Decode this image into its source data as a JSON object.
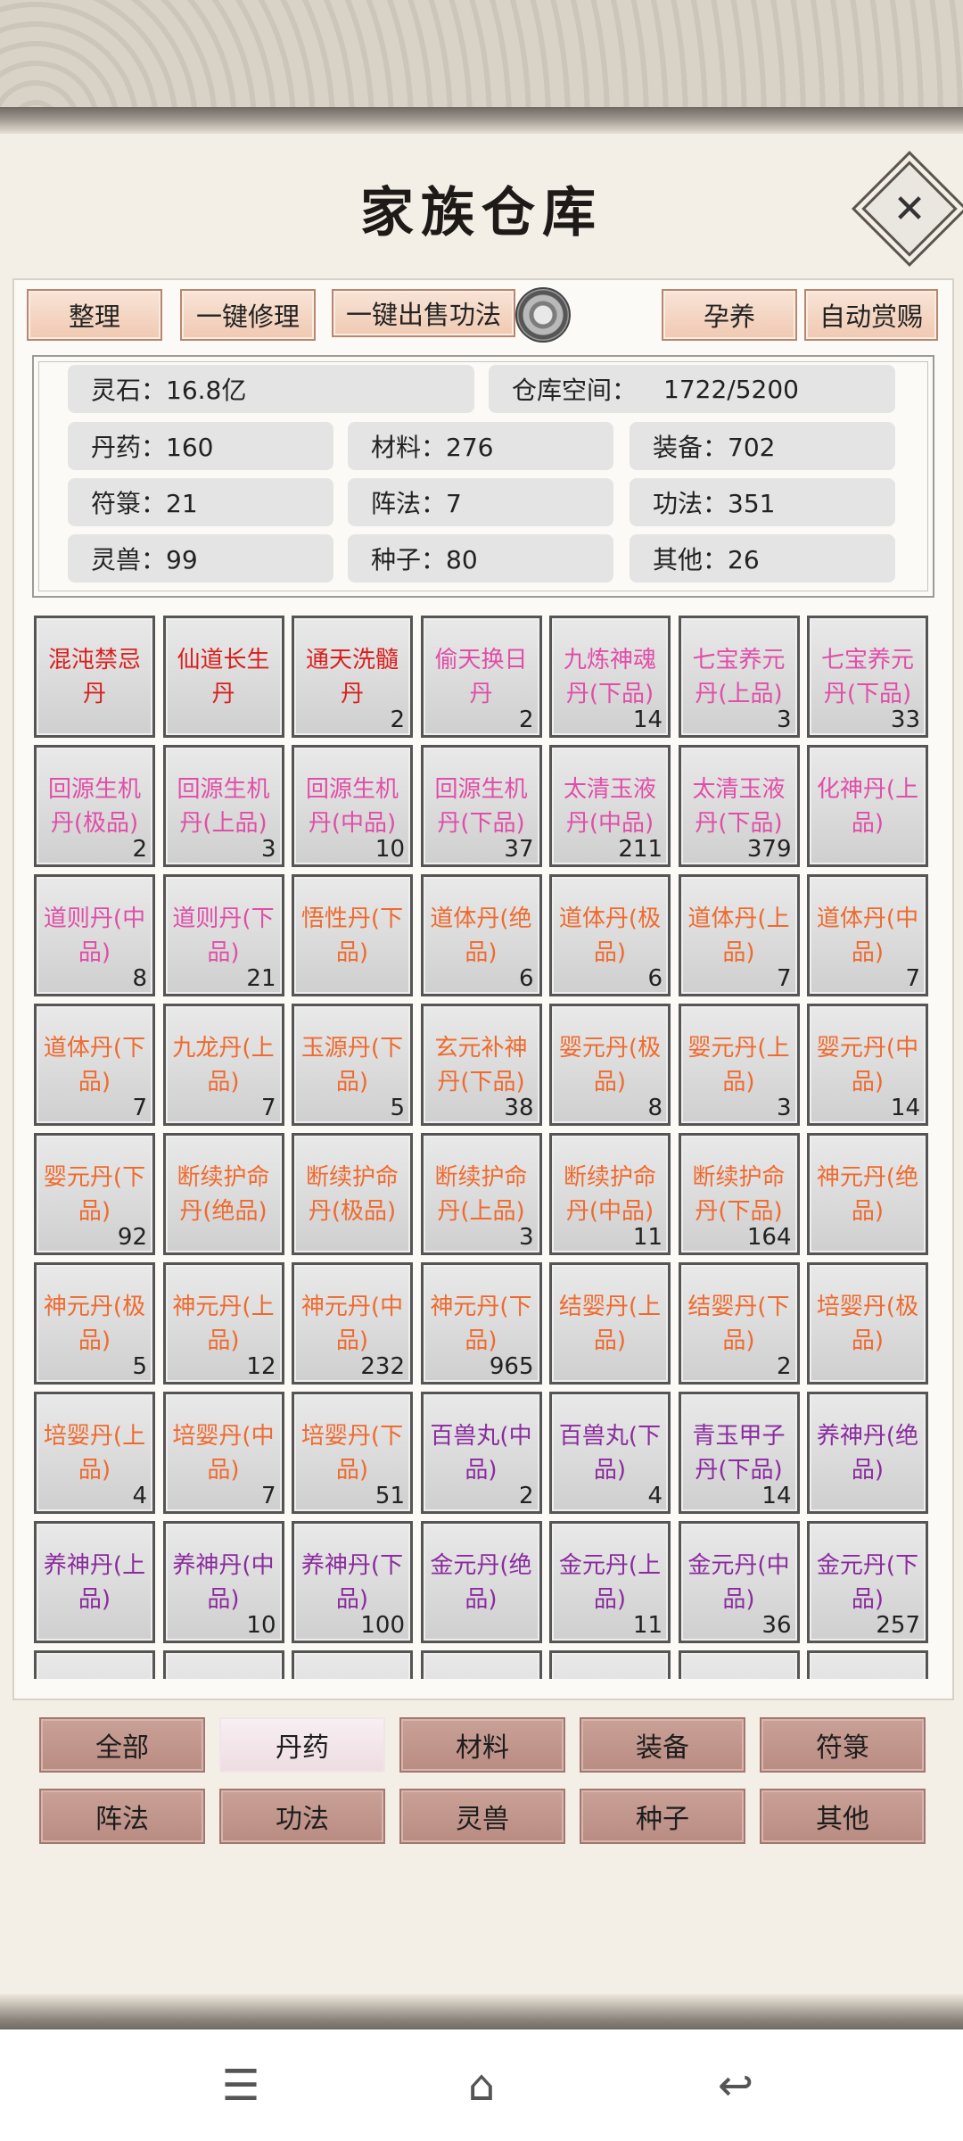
{
  "title": "家族仓库",
  "close_icon": "✕",
  "toolbar": {
    "sort": "整理",
    "repair": "一键修理",
    "sell_techniques": "一键出售功法",
    "nurture": "孕养",
    "auto_reward": "自动赏赐"
  },
  "stats": {
    "spirit_stone": "灵石：16.8亿",
    "storage_label": "仓库空间：",
    "storage_value": "1722/5200",
    "pills": "丹药：160",
    "materials": "材料：276",
    "equipment": "装备：702",
    "talismans": "符箓：21",
    "formations": "阵法：7",
    "techniques": "功法：351",
    "beasts": "灵兽：99",
    "seeds": "种子：80",
    "others": "其他：26"
  },
  "colors": {
    "red": "#d8201e",
    "magenta": "#e04ea8",
    "orange": "#ef6a2e",
    "purple": "#8a2b9e"
  },
  "items": [
    {
      "name": "混沌禁忌丹",
      "qty": "",
      "color": "red"
    },
    {
      "name": "仙道长生丹",
      "qty": "",
      "color": "red"
    },
    {
      "name": "通天洗髓丹",
      "qty": "2",
      "color": "red"
    },
    {
      "name": "偷天换日丹",
      "qty": "2",
      "color": "magenta"
    },
    {
      "name": "九炼神魂丹(下品)",
      "qty": "14",
      "color": "magenta"
    },
    {
      "name": "七宝养元丹(上品)",
      "qty": "3",
      "color": "magenta"
    },
    {
      "name": "七宝养元丹(下品)",
      "qty": "33",
      "color": "magenta"
    },
    {
      "name": "回源生机丹(极品)",
      "qty": "2",
      "color": "magenta"
    },
    {
      "name": "回源生机丹(上品)",
      "qty": "3",
      "color": "magenta"
    },
    {
      "name": "回源生机丹(中品)",
      "qty": "10",
      "color": "magenta"
    },
    {
      "name": "回源生机丹(下品)",
      "qty": "37",
      "color": "magenta"
    },
    {
      "name": "太清玉液丹(中品)",
      "qty": "211",
      "color": "magenta"
    },
    {
      "name": "太清玉液丹(下品)",
      "qty": "379",
      "color": "magenta"
    },
    {
      "name": "化神丹(上品)",
      "qty": "",
      "color": "magenta"
    },
    {
      "name": "道则丹(中品)",
      "qty": "8",
      "color": "magenta"
    },
    {
      "name": "道则丹(下品)",
      "qty": "21",
      "color": "magenta"
    },
    {
      "name": "悟性丹(下品)",
      "qty": "",
      "color": "orange"
    },
    {
      "name": "道体丹(绝品)",
      "qty": "6",
      "color": "orange"
    },
    {
      "name": "道体丹(极品)",
      "qty": "6",
      "color": "orange"
    },
    {
      "name": "道体丹(上品)",
      "qty": "7",
      "color": "orange"
    },
    {
      "name": "道体丹(中品)",
      "qty": "7",
      "color": "orange"
    },
    {
      "name": "道体丹(下品)",
      "qty": "7",
      "color": "orange"
    },
    {
      "name": "九龙丹(上品)",
      "qty": "7",
      "color": "orange"
    },
    {
      "name": "玉源丹(下品)",
      "qty": "5",
      "color": "orange"
    },
    {
      "name": "玄元补神丹(下品)",
      "qty": "38",
      "color": "orange"
    },
    {
      "name": "婴元丹(极品)",
      "qty": "8",
      "color": "orange"
    },
    {
      "name": "婴元丹(上品)",
      "qty": "3",
      "color": "orange"
    },
    {
      "name": "婴元丹(中品)",
      "qty": "14",
      "color": "orange"
    },
    {
      "name": "婴元丹(下品)",
      "qty": "92",
      "color": "orange"
    },
    {
      "name": "断续护命丹(绝品)",
      "qty": "",
      "color": "orange"
    },
    {
      "name": "断续护命丹(极品)",
      "qty": "",
      "color": "orange"
    },
    {
      "name": "断续护命丹(上品)",
      "qty": "3",
      "color": "orange"
    },
    {
      "name": "断续护命丹(中品)",
      "qty": "11",
      "color": "orange"
    },
    {
      "name": "断续护命丹(下品)",
      "qty": "164",
      "color": "orange"
    },
    {
      "name": "神元丹(绝品)",
      "qty": "",
      "color": "orange"
    },
    {
      "name": "神元丹(极品)",
      "qty": "5",
      "color": "orange"
    },
    {
      "name": "神元丹(上品)",
      "qty": "12",
      "color": "orange"
    },
    {
      "name": "神元丹(中品)",
      "qty": "232",
      "color": "orange"
    },
    {
      "name": "神元丹(下品)",
      "qty": "965",
      "color": "orange"
    },
    {
      "name": "结婴丹(上品)",
      "qty": "",
      "color": "orange"
    },
    {
      "name": "结婴丹(下品)",
      "qty": "2",
      "color": "orange"
    },
    {
      "name": "培婴丹(极品)",
      "qty": "",
      "color": "orange"
    },
    {
      "name": "培婴丹(上品)",
      "qty": "4",
      "color": "orange"
    },
    {
      "name": "培婴丹(中品)",
      "qty": "7",
      "color": "orange"
    },
    {
      "name": "培婴丹(下品)",
      "qty": "51",
      "color": "orange"
    },
    {
      "name": "百兽丸(中品)",
      "qty": "2",
      "color": "purple"
    },
    {
      "name": "百兽丸(下品)",
      "qty": "4",
      "color": "purple"
    },
    {
      "name": "青玉甲子丹(下品)",
      "qty": "14",
      "color": "purple"
    },
    {
      "name": "养神丹(绝品)",
      "qty": "",
      "color": "purple"
    },
    {
      "name": "养神丹(上品)",
      "qty": "",
      "color": "purple"
    },
    {
      "name": "养神丹(中品)",
      "qty": "10",
      "color": "purple"
    },
    {
      "name": "养神丹(下品)",
      "qty": "100",
      "color": "purple"
    },
    {
      "name": "金元丹(绝品)",
      "qty": "",
      "color": "purple"
    },
    {
      "name": "金元丹(上品)",
      "qty": "11",
      "color": "purple"
    },
    {
      "name": "金元丹(中品)",
      "qty": "36",
      "color": "purple"
    },
    {
      "name": "金元丹(下品)",
      "qty": "257",
      "color": "purple"
    }
  ],
  "tabs": [
    "全部",
    "丹药",
    "材料",
    "装备",
    "符箓",
    "阵法",
    "功法",
    "灵兽",
    "种子",
    "其他"
  ],
  "active_tab": "丹药",
  "nav": {
    "menu_icon": "☰",
    "home_icon": "⌂",
    "back_icon": "↩"
  }
}
